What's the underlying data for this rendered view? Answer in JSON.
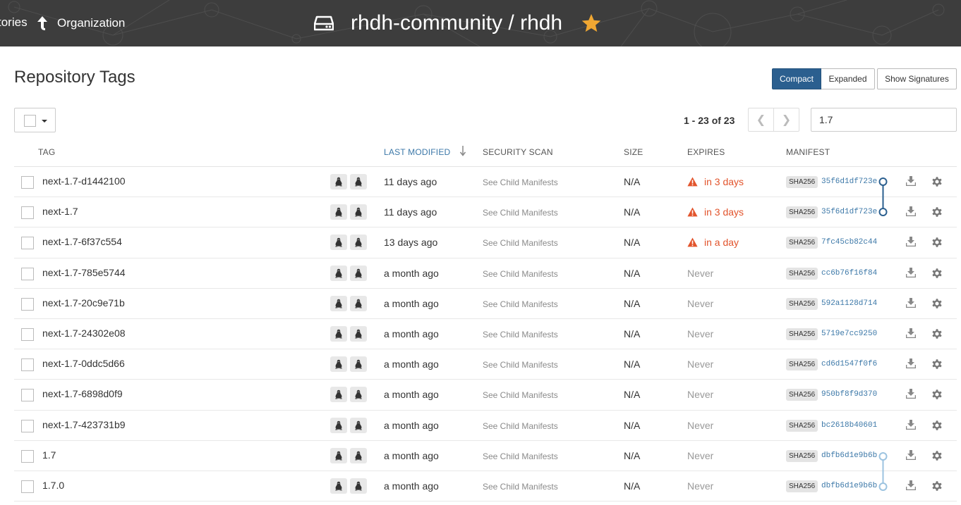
{
  "header": {
    "crumb_repos": "tories",
    "crumb_org": "Organization",
    "repo_title": "rhdh-community / rhdh"
  },
  "page": {
    "title": "Repository Tags",
    "views": {
      "compact": "Compact",
      "expanded": "Expanded",
      "signatures": "Show Signatures"
    },
    "paging": "1 - 23 of 23",
    "pager_prev": "❮",
    "pager_next": "❯",
    "filter_value": "1.7"
  },
  "columns": {
    "tag": "TAG",
    "last_modified": "LAST MODIFIED",
    "security_scan": "SECURITY SCAN",
    "size": "SIZE",
    "expires": "EXPIRES",
    "manifest": "MANIFEST"
  },
  "colors": {
    "header_bg": "#3d3d3d",
    "accent": "#2b5f8f",
    "link": "#3c78a8",
    "warning": "#e2542c",
    "star": "#f0a732"
  },
  "rows": [
    {
      "tag": "next-1.7-d1442100",
      "modified": "11 days ago",
      "scan": "See Child Manifests",
      "size": "N/A",
      "expires": "in 3 days",
      "warn": true,
      "sha": "SHA256",
      "digest": "35f6d1df723e"
    },
    {
      "tag": "next-1.7",
      "modified": "11 days ago",
      "scan": "See Child Manifests",
      "size": "N/A",
      "expires": "in 3 days",
      "warn": true,
      "sha": "SHA256",
      "digest": "35f6d1df723e"
    },
    {
      "tag": "next-1.7-6f37c554",
      "modified": "13 days ago",
      "scan": "See Child Manifests",
      "size": "N/A",
      "expires": "in a day",
      "warn": true,
      "sha": "SHA256",
      "digest": "7fc45cb82c44"
    },
    {
      "tag": "next-1.7-785e5744",
      "modified": "a month ago",
      "scan": "See Child Manifests",
      "size": "N/A",
      "expires": "Never",
      "warn": false,
      "sha": "SHA256",
      "digest": "cc6b76f16f84"
    },
    {
      "tag": "next-1.7-20c9e71b",
      "modified": "a month ago",
      "scan": "See Child Manifests",
      "size": "N/A",
      "expires": "Never",
      "warn": false,
      "sha": "SHA256",
      "digest": "592a1128d714"
    },
    {
      "tag": "next-1.7-24302e08",
      "modified": "a month ago",
      "scan": "See Child Manifests",
      "size": "N/A",
      "expires": "Never",
      "warn": false,
      "sha": "SHA256",
      "digest": "5719e7cc9250"
    },
    {
      "tag": "next-1.7-0ddc5d66",
      "modified": "a month ago",
      "scan": "See Child Manifests",
      "size": "N/A",
      "expires": "Never",
      "warn": false,
      "sha": "SHA256",
      "digest": "cd6d1547f0f6"
    },
    {
      "tag": "next-1.7-6898d0f9",
      "modified": "a month ago",
      "scan": "See Child Manifests",
      "size": "N/A",
      "expires": "Never",
      "warn": false,
      "sha": "SHA256",
      "digest": "950bf8f9d370"
    },
    {
      "tag": "next-1.7-423731b9",
      "modified": "a month ago",
      "scan": "See Child Manifests",
      "size": "N/A",
      "expires": "Never",
      "warn": false,
      "sha": "SHA256",
      "digest": "bc2618b40601"
    },
    {
      "tag": "1.7",
      "modified": "a month ago",
      "scan": "See Child Manifests",
      "size": "N/A",
      "expires": "Never",
      "warn": false,
      "sha": "SHA256",
      "digest": "dbfb6d1e9b6b"
    },
    {
      "tag": "1.7.0",
      "modified": "a month ago",
      "scan": "See Child Manifests",
      "size": "N/A",
      "expires": "Never",
      "warn": false,
      "sha": "SHA256",
      "digest": "dbfb6d1e9b6b"
    }
  ]
}
